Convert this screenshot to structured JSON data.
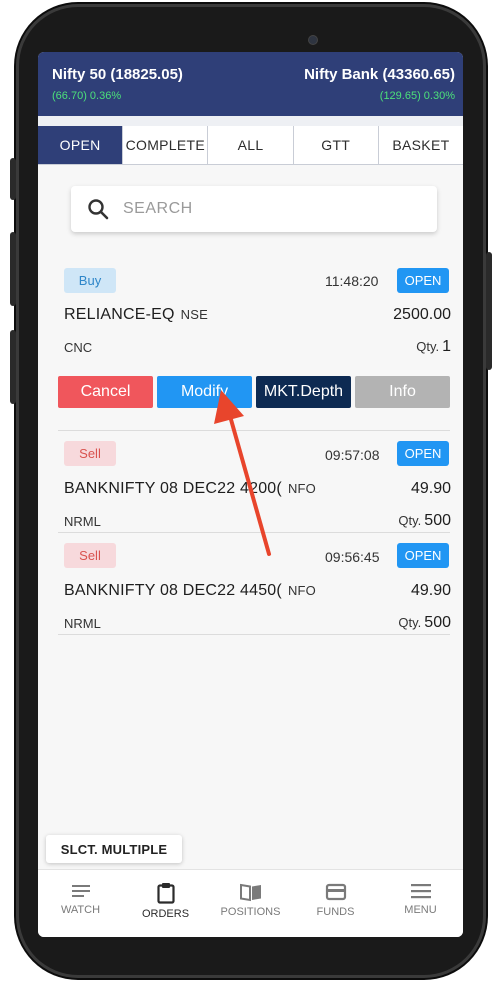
{
  "ticker": {
    "left_name": "Nifty 50 (18825.05)",
    "left_change": "(66.70) 0.36%",
    "right_name": "Nifty Bank (43360.65)",
    "right_change": "(129.65) 0.30%",
    "change_color": "#4ce07a",
    "bg_color": "#2f3f78"
  },
  "tabs": [
    {
      "label": "OPEN",
      "active": true
    },
    {
      "label": "COMPLETE",
      "active": false
    },
    {
      "label": "ALL",
      "active": false
    },
    {
      "label": "GTT",
      "active": false
    },
    {
      "label": "BASKET",
      "active": false
    }
  ],
  "search": {
    "placeholder": "SEARCH",
    "icon": "search-icon"
  },
  "orders": [
    {
      "side": "Buy",
      "time": "11:48:20",
      "status": "OPEN",
      "symbol": "RELIANCE-EQ",
      "exchange": "NSE",
      "price": "2500.00",
      "product": "CNC",
      "qty_label": "Qty.",
      "qty": "1"
    },
    {
      "side": "Sell",
      "time": "09:57:08",
      "status": "OPEN",
      "symbol": "BANKNIFTY 08 DEC22 4200(",
      "exchange": "NFO",
      "price": "49.90",
      "product": "NRML",
      "qty_label": "Qty.",
      "qty": "500"
    },
    {
      "side": "Sell",
      "time": "09:56:45",
      "status": "OPEN",
      "symbol": "BANKNIFTY 08 DEC22 4450(",
      "exchange": "NFO",
      "price": "49.90",
      "product": "NRML",
      "qty_label": "Qty.",
      "qty": "500"
    }
  ],
  "actions": {
    "cancel": "Cancel",
    "modify": "Modify",
    "depth": "MKT.Depth",
    "info": "Info"
  },
  "select_multiple": "SLCT. MULTIPLE",
  "nav": [
    {
      "label": "WATCH",
      "icon": "watch-list-icon",
      "active": false
    },
    {
      "label": "ORDERS",
      "icon": "clipboard-icon",
      "active": true
    },
    {
      "label": "POSITIONS",
      "icon": "book-icon",
      "active": false
    },
    {
      "label": "FUNDS",
      "icon": "wallet-card-icon",
      "active": false
    },
    {
      "label": "MENU",
      "icon": "hamburger-menu-icon",
      "active": false
    }
  ],
  "colors": {
    "buy": "#2e86c9",
    "sell": "#d9534f",
    "open_badge": "#2196f3",
    "cancel": "#f0565c",
    "modify": "#2196f3",
    "depth": "#0d2a52",
    "info": "#b3b3b3",
    "annotation_arrow": "#e8452c"
  }
}
